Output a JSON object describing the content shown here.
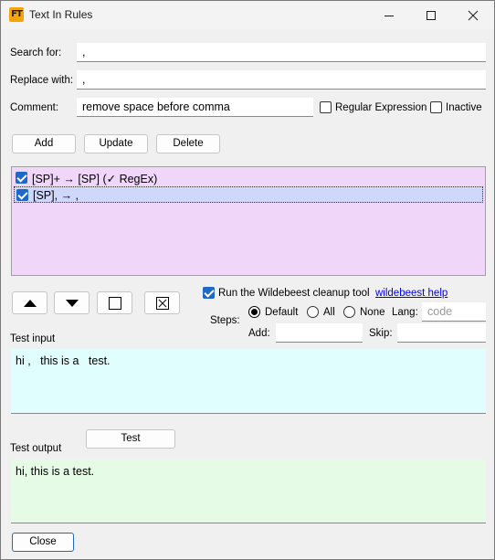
{
  "window": {
    "title": "Text In Rules",
    "app_icon": "FT"
  },
  "form": {
    "search_label": "Search for:",
    "search_value": " ,",
    "replace_label": "Replace with:",
    "replace_value": ",",
    "comment_label": "Comment:",
    "comment_value": "remove space before comma",
    "regex_label": "Regular Expression",
    "inactive_label": "Inactive"
  },
  "buttons": {
    "add": "Add",
    "update": "Update",
    "delete": "Delete",
    "test": "Test",
    "close": "Close"
  },
  "rules": [
    {
      "text": "[SP]+ → [SP] (✓ RegEx)",
      "checked": true,
      "selected": false
    },
    {
      "text": "[SP], → ,",
      "checked": true,
      "selected": true
    }
  ],
  "wildebeest": {
    "run_label": "Run the Wildebeest cleanup tool",
    "help_link": "wildebeest help",
    "steps_label": "Steps:",
    "default_label": "Default",
    "all_label": "All",
    "none_label": "None",
    "lang_label": "Lang:",
    "lang_placeholder": "code",
    "add_label": "Add:",
    "skip_label": "Skip:"
  },
  "test": {
    "input_label": "Test input",
    "input_value": "hi ,   this is a   test.",
    "output_label": "Test output",
    "output_value": "hi, this is a test."
  },
  "colors": {
    "rules_bg": "#f0d7fa",
    "test_input_bg": "#e0fefe",
    "test_output_bg": "#e6fbe6",
    "checkbox_accent": "#1e68c8",
    "app_icon": "#f5a50a"
  }
}
